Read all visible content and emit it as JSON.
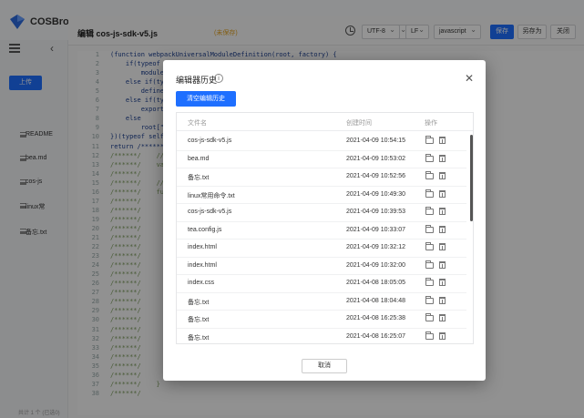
{
  "app": {
    "name": "COSBrowser"
  },
  "sidebar": {
    "upload_label": "上传",
    "files": [
      "README",
      "bea.md",
      "cos-js",
      "linux常",
      "备忘.txt"
    ],
    "status": "共计 1 个 (已选0)"
  },
  "editor": {
    "title": "编辑 cos-js-sdk-v5.js",
    "unsaved": "(未保存)",
    "encoding": "UTF-8",
    "line_ending": "LF",
    "language": "javascript",
    "save_label": "保存",
    "save_as_label": "另存为",
    "close_label": "关闭",
    "lines": [
      {
        "n": "1",
        "t": "(function webpackUniversalModuleDefinition(root, factory) {"
      },
      {
        "n": "2",
        "t": "    if(typeof"
      },
      {
        "n": "3",
        "t": "        module"
      },
      {
        "n": "4",
        "t": "    else if(ty"
      },
      {
        "n": "5",
        "t": "        define"
      },
      {
        "n": "6",
        "t": "    else if(ty"
      },
      {
        "n": "7",
        "t": "        export"
      },
      {
        "n": "8",
        "t": "    else"
      },
      {
        "n": "9",
        "t": "        root[\""
      },
      {
        "n": "10",
        "t": "})(typeof self"
      },
      {
        "n": "11",
        "t": "return /******"
      },
      {
        "n": "12",
        "t": "/******/    //"
      },
      {
        "n": "13",
        "t": "/******/    va"
      },
      {
        "n": "14",
        "t": "/******/"
      },
      {
        "n": "15",
        "t": "/******/    //"
      },
      {
        "n": "16",
        "t": "/******/    fu"
      },
      {
        "n": "17",
        "t": "/******/"
      },
      {
        "n": "18",
        "t": "/******/"
      },
      {
        "n": "19",
        "t": "/******/"
      },
      {
        "n": "20",
        "t": "/******/"
      },
      {
        "n": "21",
        "t": "/******/"
      },
      {
        "n": "22",
        "t": "/******/"
      },
      {
        "n": "23",
        "t": "/******/"
      },
      {
        "n": "24",
        "t": "/******/"
      },
      {
        "n": "25",
        "t": "/******/"
      },
      {
        "n": "26",
        "t": "/******/"
      },
      {
        "n": "27",
        "t": "/******/"
      },
      {
        "n": "28",
        "t": "/******/"
      },
      {
        "n": "29",
        "t": "/******/"
      },
      {
        "n": "30",
        "t": "/******/"
      },
      {
        "n": "31",
        "t": "/******/"
      },
      {
        "n": "32",
        "t": "/******/"
      },
      {
        "n": "33",
        "t": "/******/"
      },
      {
        "n": "34",
        "t": "/******/"
      },
      {
        "n": "35",
        "t": "/******/"
      },
      {
        "n": "36",
        "t": "/******/        return module.exports;"
      },
      {
        "n": "37",
        "t": "/******/    }"
      },
      {
        "n": "38",
        "t": "/******/"
      }
    ]
  },
  "dialog": {
    "title": "编辑器历史",
    "info_glyph": "i",
    "close_glyph": "✕",
    "clear_label": "清空编辑历史",
    "columns": {
      "name": "文件名",
      "time": "创建时间",
      "actions": "操作"
    },
    "rows": [
      {
        "name": "cos-js-sdk-v5.js",
        "time": "2021-04-09 10:54:15"
      },
      {
        "name": "bea.md",
        "time": "2021-04-09 10:53:02"
      },
      {
        "name": "备忘.txt",
        "time": "2021-04-09 10:52:56"
      },
      {
        "name": "linux常用命令.txt",
        "time": "2021-04-09 10:49:30"
      },
      {
        "name": "cos-js-sdk-v5.js",
        "time": "2021-04-09 10:39:53"
      },
      {
        "name": "tea.config.js",
        "time": "2021-04-09 10:33:07"
      },
      {
        "name": "index.html",
        "time": "2021-04-09 10:32:12"
      },
      {
        "name": "index.html",
        "time": "2021-04-09 10:32:00"
      },
      {
        "name": "index.css",
        "time": "2021-04-08 18:05:05"
      },
      {
        "name": "备忘.txt",
        "time": "2021-04-08 18:04:48"
      },
      {
        "name": "备忘.txt",
        "time": "2021-04-08 16:25:38"
      },
      {
        "name": "备忘.txt",
        "time": "2021-04-08 16:25:07"
      }
    ],
    "cancel_label": "取消"
  },
  "colors": {
    "accent": "#1e6fff",
    "unsaved": "#e0a020",
    "overlay": "rgba(0,0,0,0.42)"
  }
}
